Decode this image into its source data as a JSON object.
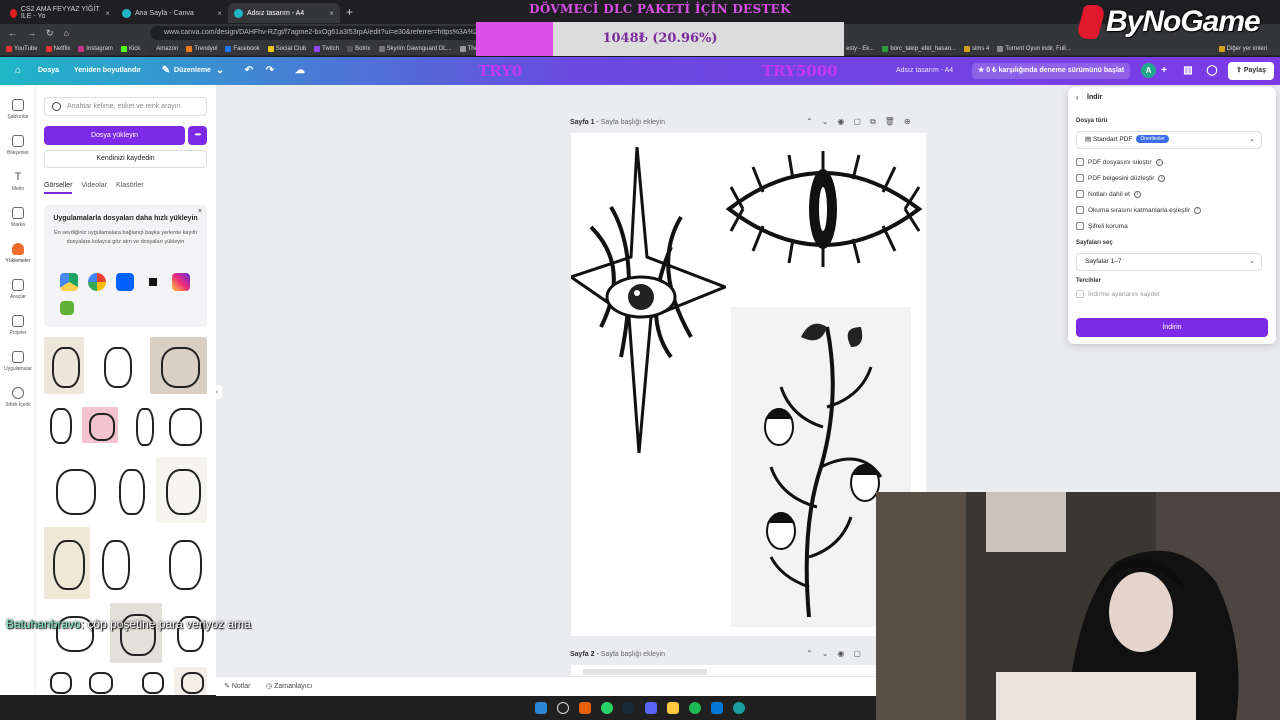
{
  "browser": {
    "tabs": [
      {
        "title": "CS2 AMA FEYYAZ YİĞİT İLE - Yo",
        "active": false,
        "color": "#e02020"
      },
      {
        "title": "Ana Sayfa - Canva",
        "active": false,
        "color": "#1fb6c7"
      },
      {
        "title": "Adsız tasarım - A4",
        "active": true,
        "color": "#1fb6c7"
      }
    ],
    "new_tab": "+",
    "url": "www.canva.com/design/DAHFhv-RZgt/f7agme2-bxOg61a3I53rpA/edit?ui=e30&referrer=https%3A%2F",
    "bookmarks": [
      "YouTube",
      "Netflix",
      "Instagram",
      "Kick",
      "Amazon",
      "Trendyol",
      "Facebook",
      "Social Club",
      "Twitch",
      "Botrix",
      "Skyrim Dawnguard DL...",
      "The E"
    ],
    "bookmarks_right": [
      "esty - Ek...",
      "borc_takip_efet_hasan...",
      "sims 4",
      "Torrent Oyun indir, Full...",
      "Diğer yer imleri"
    ]
  },
  "overlay": {
    "donation_title": "DÖVMECİ DLC PAKETİ İÇİN DESTEK",
    "donation_progress_text": "1048₺ (20.96%)",
    "donation_progress": 0.2096,
    "logo_text": "ByNoGame",
    "chat_user": "Batuhanbravo",
    "chat_message": ": çöp poşetine para veriyoz ama"
  },
  "canva": {
    "header": {
      "file": "Dosya",
      "resize": "Yeniden boyutlandır",
      "editing": "Düzenleme",
      "try_left": "TRY0",
      "try_right": "TRY5000",
      "doc_title": "Adsız tasarım - A4",
      "trial": "0 ₺ karşılığında deneme sürümünü başlat",
      "avatar_letter": "A",
      "share": "Paylaş"
    },
    "rail": [
      "Şablonlar",
      "Bileşenler",
      "Metin",
      "Marka",
      "Yüklemeler",
      "Araçlar",
      "Projeler",
      "Uygulamalar",
      "Sihirli İçerik"
    ],
    "panel": {
      "search_placeholder": "Anahtar kelime, etiket ve renk arayın",
      "upload_button": "Dosya yükleyin",
      "more_button": "•••",
      "record_button": "Kendinizi kaydedin",
      "tabs": [
        "Görseller",
        "Videolar",
        "Klasörler"
      ],
      "promo_title": "Uygulamalarla dosyaları daha hızlı yükleyin",
      "promo_body": "En sevdiğiniz uygulamalara bağlanıp başka yerlerde kayıtlı dosyalara kolayca göz atın ve dosyaları yükleyin",
      "promo_close": "×"
    },
    "pages": {
      "page1_label": "Sayfa 1",
      "page1_title": "Sayfa başlığı ekleyin",
      "page2_label": "Sayfa 2",
      "page2_title": "Sayfa başlığı ekleyin"
    },
    "bottom": {
      "notes": "Notlar",
      "timer": "Zamanlayıcı"
    },
    "download": {
      "back": "‹",
      "title": "İndir",
      "file_type_label": "Dosya türü",
      "file_type_value": "Standart PDF",
      "recommended_badge": "Önerilenler",
      "options": [
        "PDF dosyasını sıkıştır",
        "PDF belgesini düzleştir",
        "Notları dahil et",
        "Okuma sırasını katmanlarla eşleştir",
        "Şifreli koruma"
      ],
      "pages_label": "Sayfaları seç",
      "pages_value": "Sayfalar 1–7",
      "prefs_label": "Tercihler",
      "prefs_option": "İndirme ayarlarını kaydet",
      "download_button": "İndirin"
    }
  }
}
